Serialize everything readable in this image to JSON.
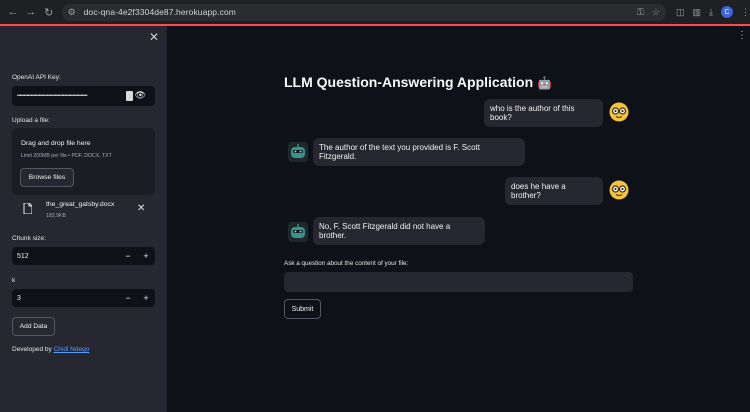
{
  "browser": {
    "url": "doc-qna-4e2f3304de87.herokuapp.com",
    "profile_initial": "C"
  },
  "sidebar": {
    "api_key_label": "OpenAI API Key:",
    "api_key_masked": "••••••••••••••••••••••••••••••••••••••••••••••••••••",
    "upload_label": "Upload a file:",
    "dropzone_title": "Drag and drop file here",
    "dropzone_limit": "Limit 200MB per file • PDF, DOCX, TXT",
    "browse_label": "Browse files",
    "file_name": "the_great_gatsby.docx",
    "file_size": "182.9KB",
    "chunk_label": "Chunk size:",
    "chunk_value": "512",
    "k_label": "k",
    "k_value": "3",
    "add_data_label": "Add Data",
    "developed_by": "Developed by ",
    "developer_name": "Chidi Ndego"
  },
  "main": {
    "title": "LLM Question-Answering Application",
    "title_emoji": "🤖",
    "messages": [
      {
        "role": "user",
        "text": "who is the author of this book?"
      },
      {
        "role": "assistant",
        "text": "The author of the text you provided is F. Scott Fitzgerald."
      },
      {
        "role": "user",
        "text": "does he have a brother?"
      },
      {
        "role": "assistant",
        "text": "No, F. Scott Fitzgerald did not have a brother."
      }
    ],
    "ask_label": "Ask a question about the content of your file:",
    "ask_value": "",
    "submit_label": "Submit"
  },
  "colors": {
    "sidebar_bg": "#262730",
    "main_bg": "#0e1117",
    "accent": "#ff4b4b",
    "link": "#5a9cf8"
  }
}
